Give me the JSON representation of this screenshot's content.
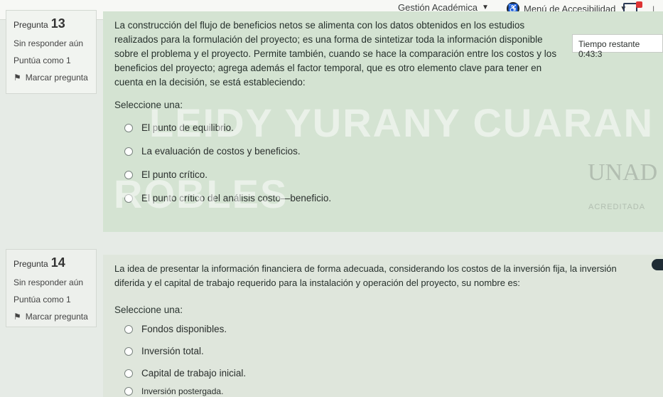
{
  "header": {
    "menu_academic": "Gestión Académica",
    "menu_accessibility": "Menú de Accesibilidad",
    "user_initial": "L"
  },
  "timer": {
    "label": "Tiempo restante",
    "value": "0:43:3"
  },
  "watermark": {
    "line1": "LEIDY YURANY CUARAN",
    "line2": "ROBLES"
  },
  "logo": {
    "name": "UNAD",
    "accreditation": "ACREDITADA"
  },
  "questions": [
    {
      "number_label": "Pregunta",
      "number": "13",
      "status": "Sin responder aún",
      "points": "Puntúa como 1",
      "flag": "Marcar pregunta",
      "text": "La construcción del flujo de beneficios netos se alimenta con los datos obtenidos en los estudios realizados para la formulación del proyecto; es una forma de sintetizar toda la información disponible sobre el problema y el proyecto. Permite también, cuando se hace la comparación entre los costos y los beneficios del proyecto; agrega además el factor temporal, que es otro elemento clave para tener en cuenta en la decisión, se está estableciendo:",
      "prompt": "Seleccione una:",
      "options": [
        "El punto de equilibrio.",
        "La evaluación de costos y beneficios.",
        "El punto crítico.",
        "El punto crítico del análisis costo—beneficio."
      ]
    },
    {
      "number_label": "Pregunta",
      "number": "14",
      "status": "Sin responder aún",
      "points": "Puntúa como 1",
      "flag": "Marcar pregunta",
      "text": "La idea de presentar la información financiera de forma adecuada, considerando los costos de la inversión fija, la inversión diferida y el capital de trabajo requerido para la instalación y operación del proyecto, su nombre es:",
      "prompt": "Seleccione una:",
      "options": [
        "Fondos disponibles.",
        "Inversión total.",
        "Capital de trabajo inicial.",
        "Inversión postergada."
      ]
    }
  ]
}
